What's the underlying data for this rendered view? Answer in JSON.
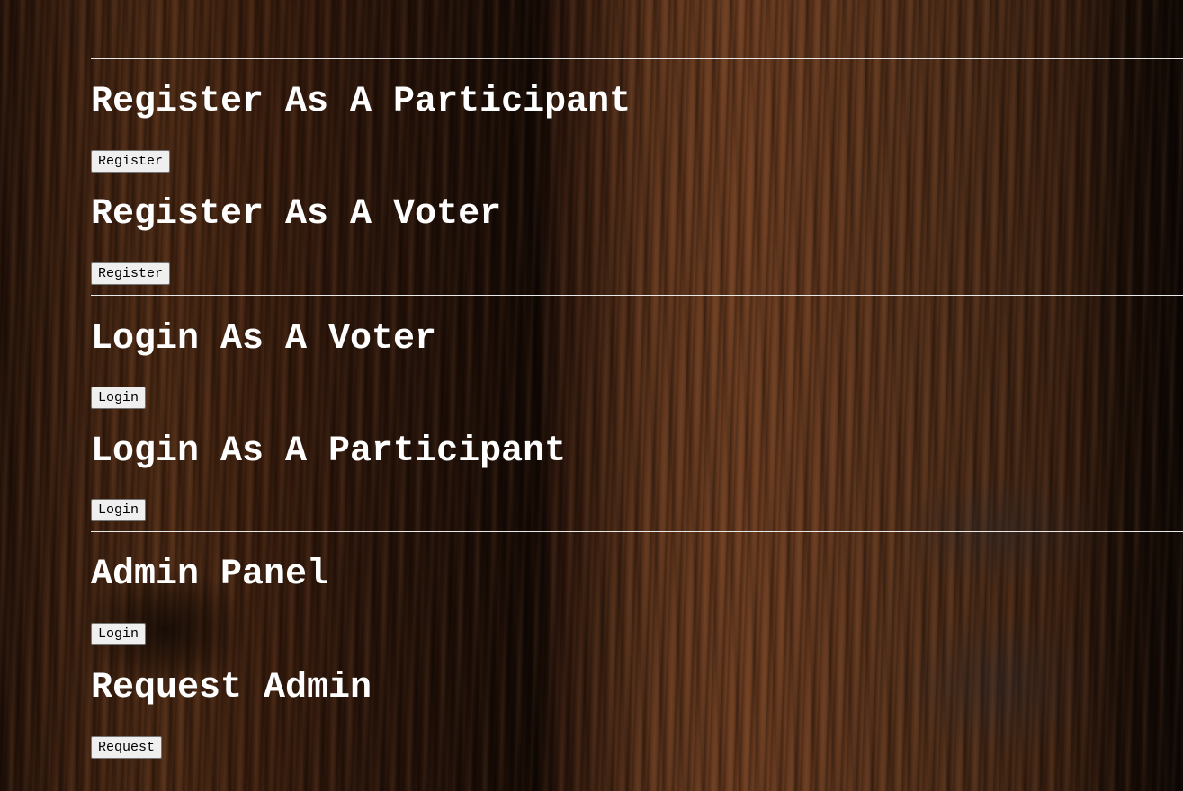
{
  "sections": {
    "register_participant": {
      "title": "Register As A Participant",
      "button_label": "Register"
    },
    "register_voter": {
      "title": "Register As A Voter",
      "button_label": "Register"
    },
    "login_voter": {
      "title": "Login As A Voter",
      "button_label": "Login"
    },
    "login_participant": {
      "title": "Login As A Participant",
      "button_label": "Login"
    },
    "admin_panel": {
      "title": "Admin Panel",
      "button_label": "Login"
    },
    "request_admin": {
      "title": "Request Admin",
      "button_label": "Request"
    }
  },
  "colors": {
    "text": "#ffffff",
    "rule": "#e8e8e8",
    "button_bg": "#efefef",
    "background_wood": "#3a1f10"
  }
}
